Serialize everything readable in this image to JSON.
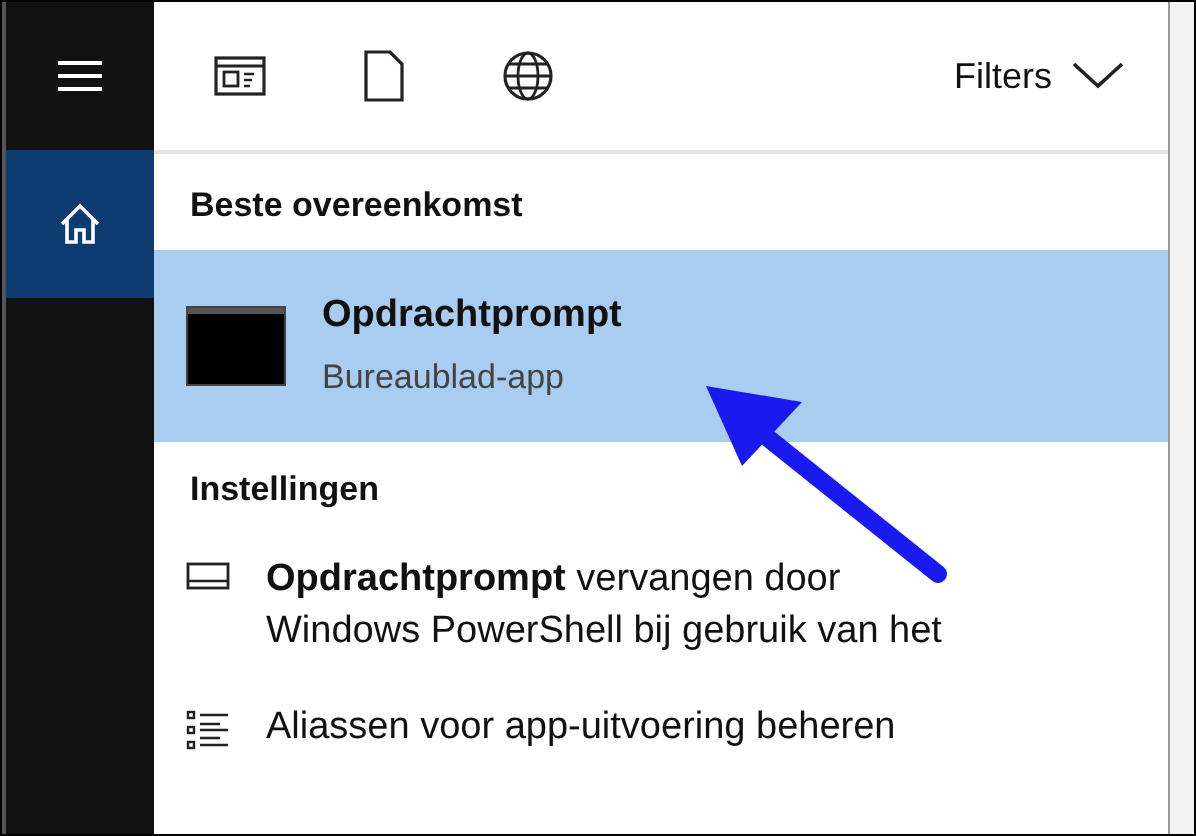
{
  "nav": {
    "items": [
      {
        "kind": "menu",
        "selected": false
      },
      {
        "kind": "home",
        "selected": true
      }
    ]
  },
  "toolbar": {
    "filters_label": "Filters"
  },
  "best_match": {
    "heading": "Beste overeenkomst",
    "result": {
      "title": "Opdrachtprompt",
      "subtitle": "Bureaublad-app",
      "selected": true
    }
  },
  "settings": {
    "heading": "Instellingen",
    "items": [
      {
        "kind": "display",
        "text": "**Opdrachtprompt** vervangen door Windows PowerShell bij gebruik van het"
      },
      {
        "kind": "list",
        "text": "Aliassen voor app-uitvoering beheren"
      }
    ]
  }
}
